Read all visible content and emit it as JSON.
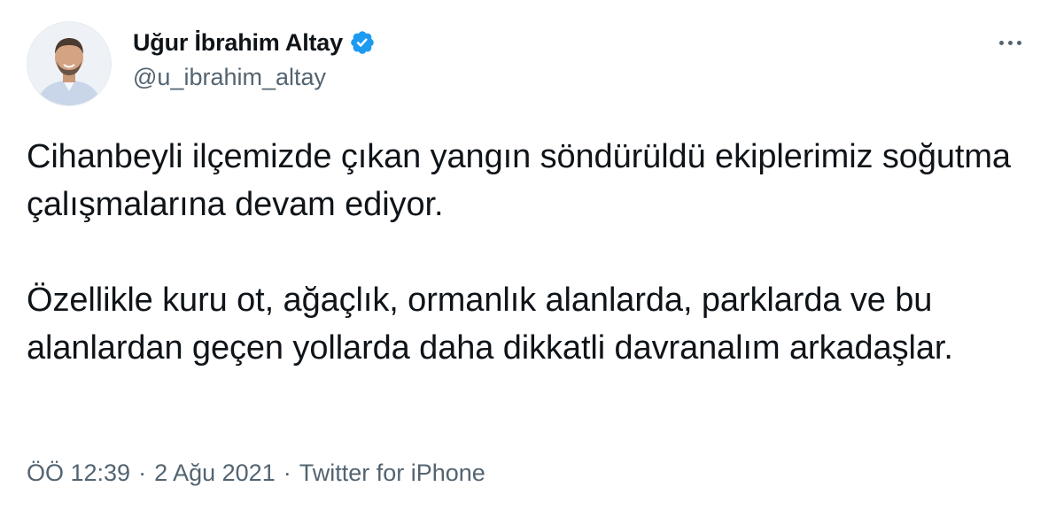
{
  "author": {
    "display_name": "Uğur İbrahim Altay",
    "handle": "@u_ibrahim_altay",
    "verified": true,
    "avatar_icon": "profile-photo"
  },
  "menu": {
    "more_icon": "more-horizontal-icon"
  },
  "tweet": {
    "paragraphs": [
      "Cihanbeyli ilçemizde çıkan yangın söndürüldü ekiplerimiz soğutma çalışmalarına devam ediyor.",
      "Özellikle kuru ot, ağaçlık, ormanlık alanlarda, parklarda ve bu alanlardan geçen yollarda daha dikkatli davranalım arkadaşlar."
    ]
  },
  "meta": {
    "time": "ÖÖ 12:39",
    "separator": "·",
    "date": "2 Ağu 2021",
    "source": "Twitter for iPhone"
  },
  "colors": {
    "text": "#0f1419",
    "secondary": "#536471",
    "verified": "#1d9bf0"
  }
}
